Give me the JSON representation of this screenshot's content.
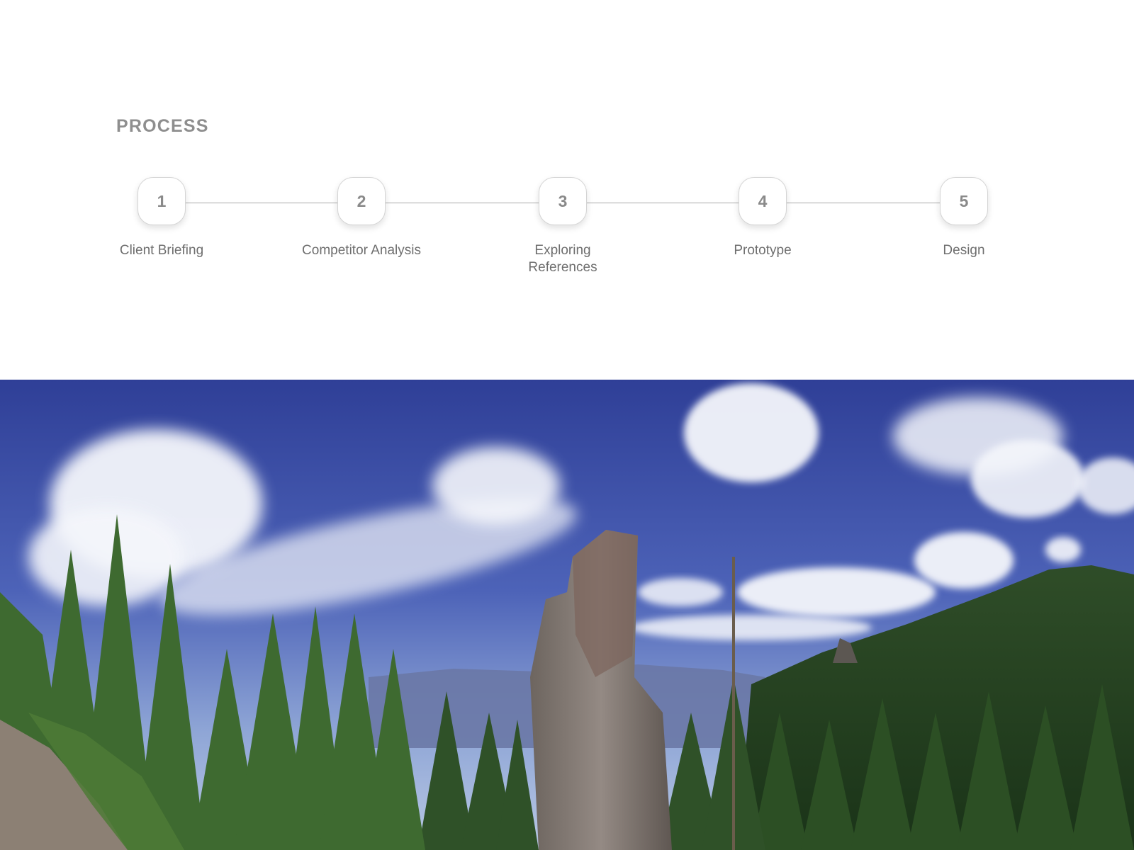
{
  "section": {
    "title": "PROCESS"
  },
  "steps": [
    {
      "number": "1",
      "label": "Client Briefing"
    },
    {
      "number": "2",
      "label": "Competitor Analysis"
    },
    {
      "number": "3",
      "label": "Exploring References"
    },
    {
      "number": "4",
      "label": "Prototype"
    },
    {
      "number": "5",
      "label": "Design"
    }
  ],
  "colors": {
    "title": "#8e8e8e",
    "badge_text": "#8a8a8a",
    "label_text": "#6e6e6e",
    "connector": "#a9a9a9",
    "sky": "#3f52a8",
    "forest": "#2f5a2a",
    "rock": "#7d726c"
  }
}
